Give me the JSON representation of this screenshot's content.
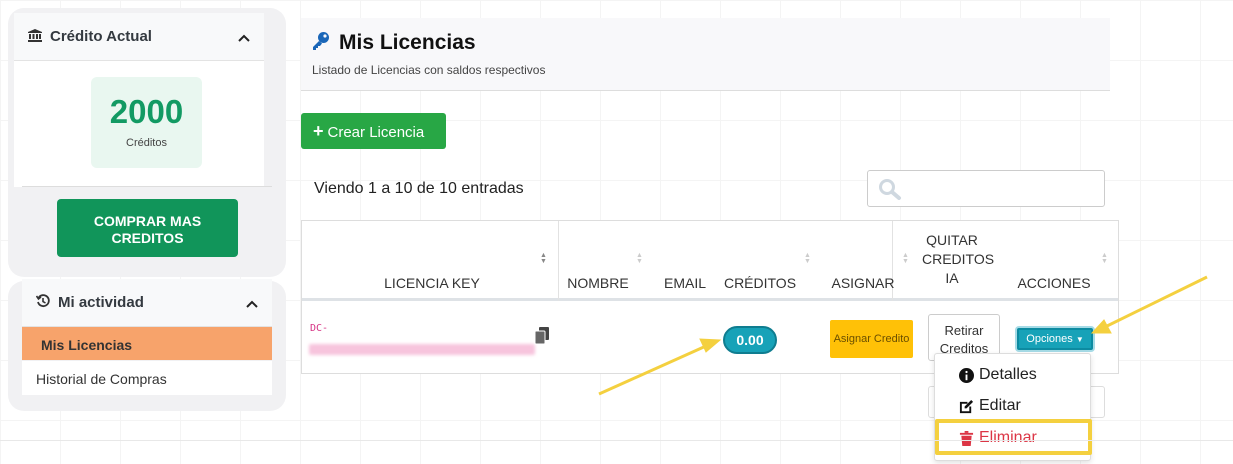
{
  "sidebar": {
    "credit_card": {
      "title": "Crédito Actual",
      "value": "2000",
      "unit": "Créditos",
      "buy_button": "COMPRAR MAS CREDITOS"
    },
    "activity_card": {
      "title": "Mi actividad",
      "items": [
        {
          "label": "Mis Licencias",
          "active": true
        },
        {
          "label": "Historial de Compras",
          "active": false
        }
      ]
    }
  },
  "main": {
    "title": "Mis Licencias",
    "subtitle": "Listado de Licencias con saldos respectivos",
    "create_button": "Crear Licencia",
    "entries_info": "Viendo 1 a 10 de 10 entradas",
    "table": {
      "headers": [
        "LICENCIA KEY",
        "NOMBRE",
        "EMAIL",
        "CRÉDITOS",
        "ASIGNAR",
        "QUITAR CREDITOS IA",
        "ACCIONES"
      ],
      "rows": [
        {
          "license_prefix": "DC-",
          "credits": "0.00",
          "assign_button": "Asignar Credito",
          "retire_button": "Retirar Creditos",
          "options_button": "Opciones"
        }
      ]
    },
    "dropdown": {
      "items": [
        {
          "label": "Detalles",
          "icon": "info-circle-icon"
        },
        {
          "label": "Editar",
          "icon": "edit-icon"
        },
        {
          "label": "Eliminar",
          "icon": "trash-icon"
        }
      ]
    }
  },
  "colors": {
    "credit_green": "#129a63",
    "buy_button": "#11955a",
    "active_nav": "#f7a36b",
    "create_button": "#28a745",
    "info_teal": "#17a2b8",
    "warning_yellow": "#ffc107",
    "danger_red": "#dc3545",
    "annotation_yellow": "#f4d03f"
  }
}
